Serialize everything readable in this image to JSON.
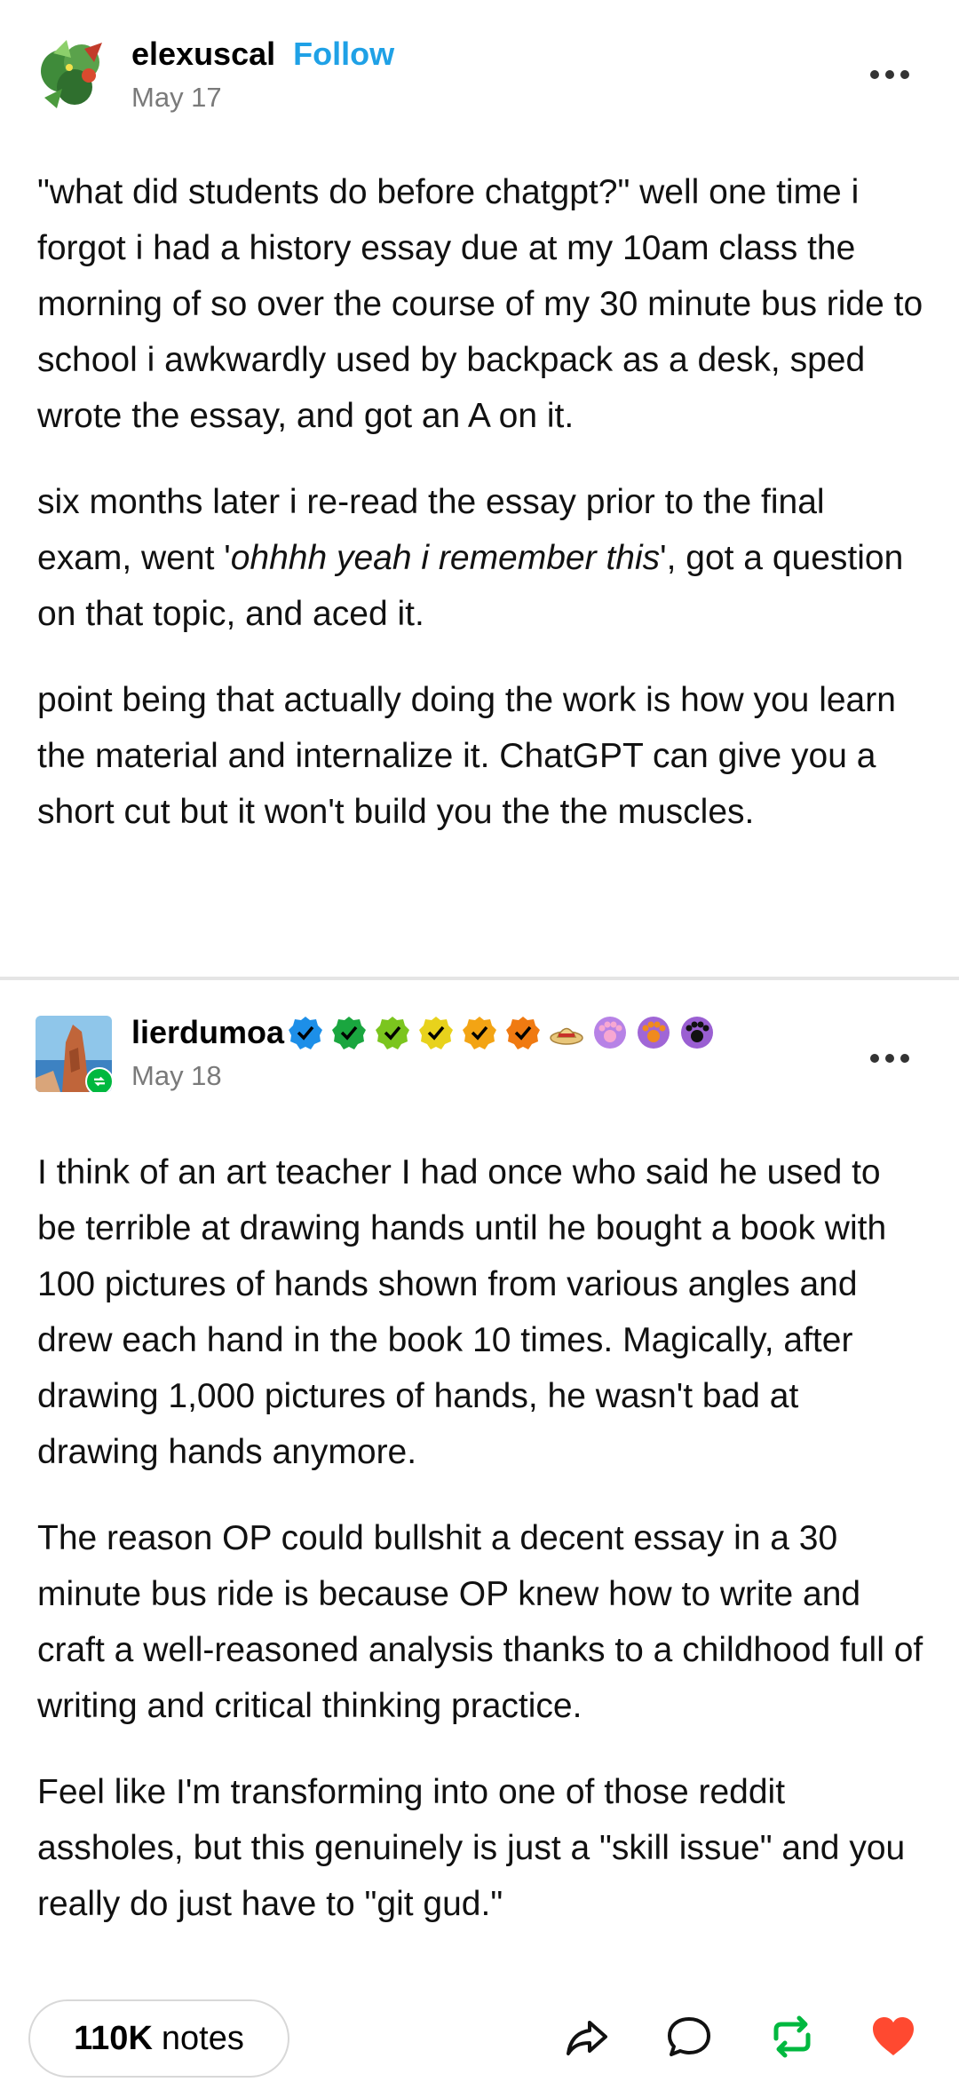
{
  "post1": {
    "username": "elexuscal",
    "follow_label": "Follow",
    "date": "May 17",
    "paragraphs": [
      "\"what did students do before chatgpt?\" well one time i forgot i had a history essay due at my 10am class the morning of so over the course of my 30 minute bus ride to school i awkwardly used by backpack as a desk, sped wrote the essay, and got an A on it.",
      "six months later i re-read the essay prior to the final exam, went '",
      "ohhhh yeah i remember this",
      "', got a question on that topic, and aced it.",
      "point being that actually doing the work is how you learn the material and internalize it. ChatGPT can give you a short cut but it won't build you the the muscles."
    ]
  },
  "post2": {
    "username": "lierdumoa",
    "date": "May 18",
    "paragraphs": [
      "I think of an art teacher I had once who said he used to be terrible at drawing hands until he bought a book with 100 pictures of hands shown from various angles and drew each hand in the book 10 times. Magically, after drawing 1,000 pictures of hands, he wasn't bad at drawing hands anymore.",
      "The reason OP could bullshit a decent essay in a 30 minute bus ride is because OP knew how to write and craft a well-reasoned analysis thanks to a childhood full of writing and critical thinking practice.",
      "Feel like I'm transforming into one of those reddit assholes, but this genuinely is just a \"skill issue\" and you really do just have to \"git gud.\""
    ],
    "badge_colors": [
      "#1d8fe8",
      "#1aa63f",
      "#7bc51e",
      "#e8d21c",
      "#f3a414",
      "#f07a11"
    ]
  },
  "footer": {
    "notes_count": "110K",
    "notes_label": "notes"
  },
  "colors": {
    "follow": "#1fa1e6",
    "reblog": "#00b83f",
    "like": "#ff4930"
  }
}
